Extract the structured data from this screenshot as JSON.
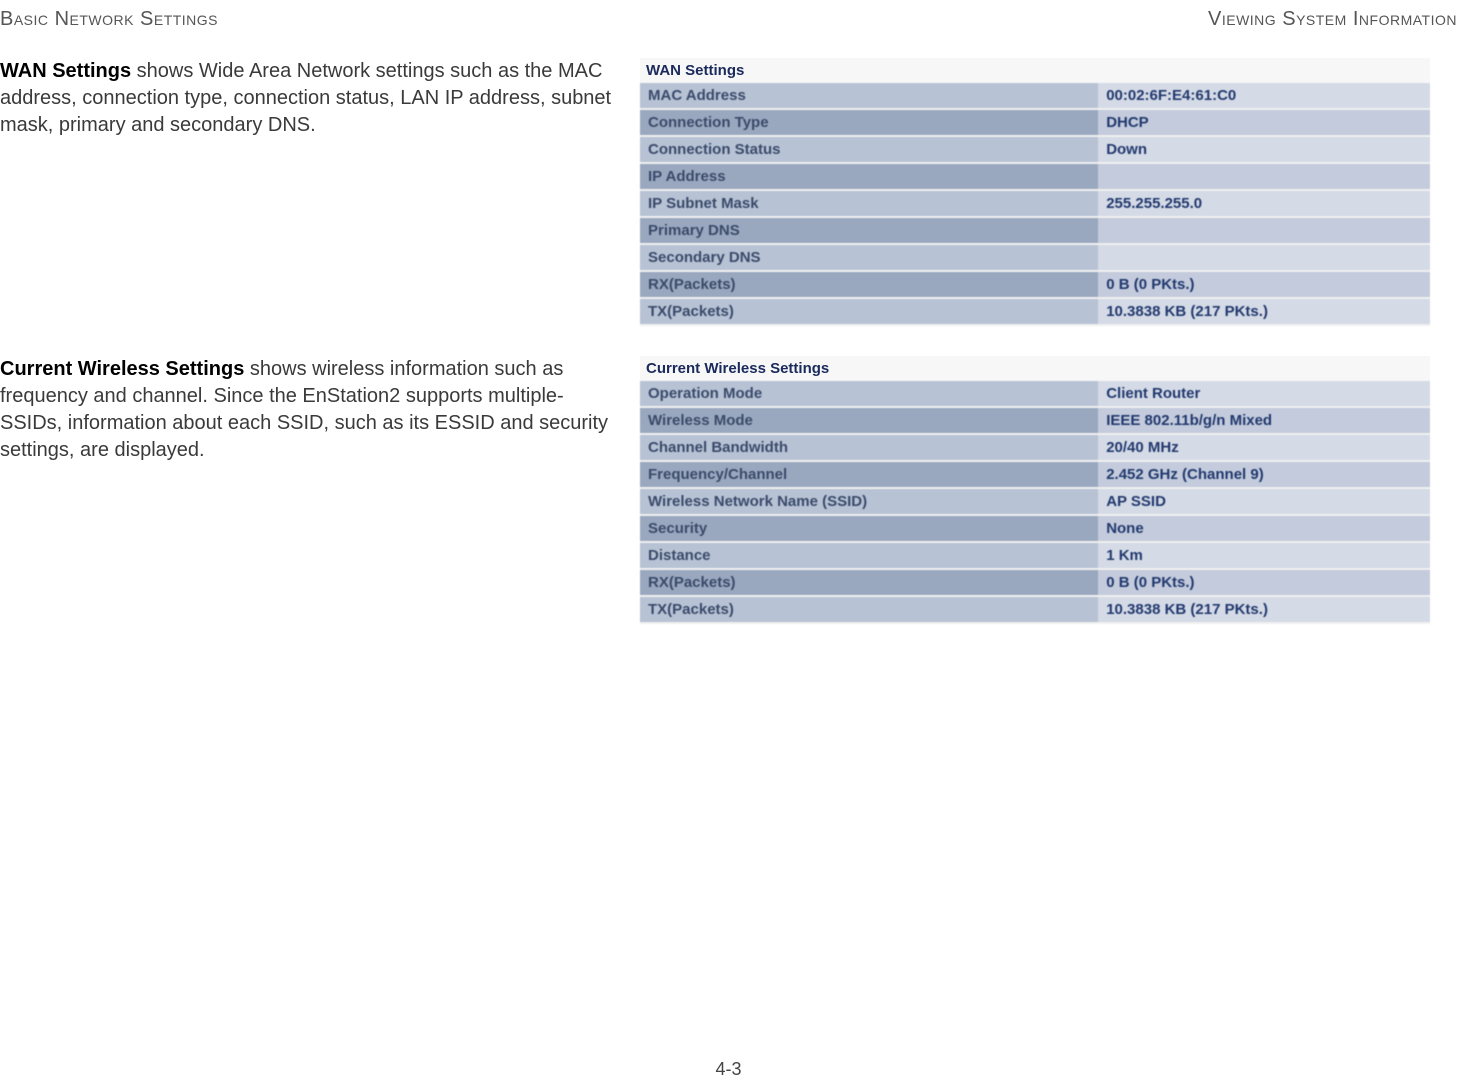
{
  "header": {
    "left": "Basic Network Settings",
    "right": "Viewing System Information"
  },
  "page_number": "4-3",
  "sections": {
    "wan": {
      "desc_bold": "WAN Settings",
      "desc_rest": "  shows Wide Area Network settings such as the MAC address, connection type, connection status, LAN IP address, subnet mask, primary and secondary DNS.",
      "panel_title": "WAN Settings",
      "rows": [
        {
          "label": "MAC Address",
          "value": "00:02:6F:E4:61:C0"
        },
        {
          "label": "Connection Type",
          "value": "DHCP"
        },
        {
          "label": "Connection Status",
          "value": "Down"
        },
        {
          "label": "IP Address",
          "value": ""
        },
        {
          "label": "IP Subnet Mask",
          "value": "255.255.255.0"
        },
        {
          "label": "Primary DNS",
          "value": ""
        },
        {
          "label": "Secondary DNS",
          "value": ""
        },
        {
          "label": "RX(Packets)",
          "value": "0 B (0 PKts.)"
        },
        {
          "label": "TX(Packets)",
          "value": "10.3838 KB (217 PKts.)"
        }
      ]
    },
    "wireless": {
      "desc_bold": "Current Wireless Settings",
      "desc_rest": "  shows wireless information such as frequency and channel. Since the EnStation2 supports multiple-SSIDs, information about each SSID, such as its ESSID and security settings, are displayed.",
      "panel_title": "Current Wireless Settings",
      "rows": [
        {
          "label": "Operation Mode",
          "value": "Client Router"
        },
        {
          "label": "Wireless Mode",
          "value": "IEEE 802.11b/g/n Mixed"
        },
        {
          "label": "Channel Bandwidth",
          "value": "20/40 MHz"
        },
        {
          "label": "Frequency/Channel",
          "value": "2.452 GHz (Channel 9)"
        },
        {
          "label": "Wireless Network Name (SSID)",
          "value": "AP SSID"
        },
        {
          "label": "Security",
          "value": "None"
        },
        {
          "label": "Distance",
          "value": "1 Km"
        },
        {
          "label": "RX(Packets)",
          "value": "0 B (0 PKts.)"
        },
        {
          "label": "TX(Packets)",
          "value": "10.3838 KB (217 PKts.)"
        }
      ]
    }
  }
}
